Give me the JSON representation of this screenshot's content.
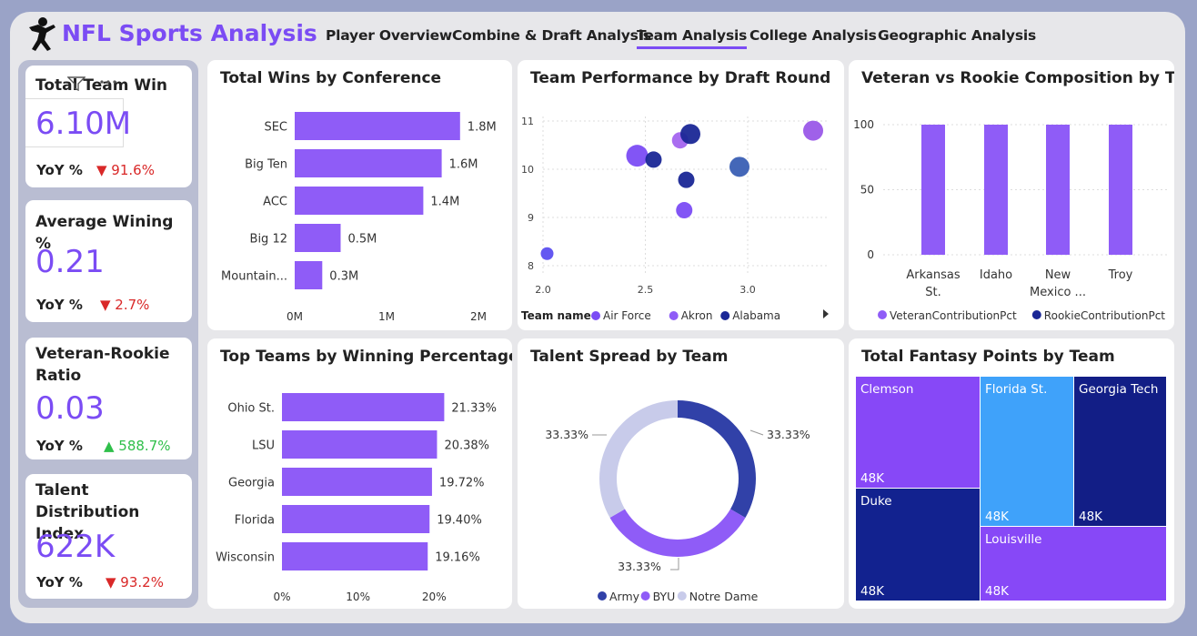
{
  "app": {
    "title": "NFL Sports Analysis"
  },
  "nav": {
    "items": [
      {
        "label": "Player Overview"
      },
      {
        "label": "Combine & Draft Analysis"
      },
      {
        "label": "Team Analysis"
      },
      {
        "label": "College Analysis"
      },
      {
        "label": "Geographic Analysis"
      }
    ],
    "active": "Team Analysis"
  },
  "kpis": [
    {
      "title": "Total Team Win",
      "value": "6.10M",
      "yoy_label": "YoY %",
      "yoy": "▼ 91.6%",
      "direction": "down"
    },
    {
      "title": "Average Wining %",
      "value": "0.21",
      "yoy_label": "YoY %",
      "yoy": "▼ 2.7%",
      "direction": "down"
    },
    {
      "title": "Veteran-Rookie Ratio",
      "value": "0.03",
      "yoy_label": "YoY %",
      "yoy": "▲ 588.7%",
      "direction": "up"
    },
    {
      "title": "Talent Distribution Index",
      "value": "622K",
      "yoy_label": "YoY %",
      "yoy": "▼ 93.2%",
      "direction": "down"
    }
  ],
  "colors": {
    "accent": "#7b4cf4",
    "bar": "#8f5cf7",
    "navy": "#1a2796",
    "blue": "#3a5fb4",
    "light": "#c8cbea",
    "sky": "#3fa2fa",
    "down": "#d92828",
    "up": "#2fbf4a"
  },
  "chart_data": [
    {
      "id": "wins_by_conference",
      "type": "bar",
      "title": "Total Wins by Conference",
      "orientation": "horizontal",
      "categories": [
        "SEC",
        "Big Ten",
        "ACC",
        "Big 12",
        "Mountain..."
      ],
      "values": [
        1.8,
        1.6,
        1.4,
        0.5,
        0.3
      ],
      "value_labels": [
        "1.8M",
        "1.6M",
        "1.4M",
        "0.5M",
        "0.3M"
      ],
      "xlim": [
        0,
        2
      ],
      "xticks": [
        "0M",
        "1M",
        "2M"
      ]
    },
    {
      "id": "top_teams_winning_pct",
      "type": "bar",
      "title": "Top Teams by Winning Percentage",
      "orientation": "horizontal",
      "categories": [
        "Ohio St.",
        "LSU",
        "Georgia",
        "Florida",
        "Wisconsin"
      ],
      "values": [
        21.33,
        20.38,
        19.72,
        19.4,
        19.16
      ],
      "value_labels": [
        "21.33%",
        "20.38%",
        "19.72%",
        "19.40%",
        "19.16%"
      ],
      "xlim": [
        0,
        22
      ],
      "xticks": [
        "0%",
        "10%",
        "20%"
      ]
    },
    {
      "id": "performance_by_draft_round",
      "type": "scatter",
      "title": "Team Performance by Draft Round",
      "xlim": [
        2.0,
        3.4
      ],
      "ylim": [
        8,
        11
      ],
      "xticks": [
        "2.0",
        "2.5",
        "3.0"
      ],
      "yticks": [
        "11",
        "10",
        "9",
        "8"
      ],
      "legend_title": "Team name",
      "legend": [
        {
          "name": "Air Force",
          "color": "#7b4cf4"
        },
        {
          "name": "Akron",
          "color": "#8f5cf7"
        },
        {
          "name": "Alabama",
          "color": "#1a2796"
        }
      ],
      "points": [
        {
          "x": 2.02,
          "y": 8.25,
          "color": "#5c4ff0"
        },
        {
          "x": 2.46,
          "y": 10.28,
          "color": "#7b4cf4"
        },
        {
          "x": 2.54,
          "y": 10.2,
          "color": "#1a2796"
        },
        {
          "x": 2.67,
          "y": 10.6,
          "color": "#a465ef"
        },
        {
          "x": 2.72,
          "y": 10.73,
          "color": "#1a2796"
        },
        {
          "x": 2.7,
          "y": 9.78,
          "color": "#1a2796"
        },
        {
          "x": 2.69,
          "y": 9.15,
          "color": "#7b4cf4"
        },
        {
          "x": 2.96,
          "y": 10.05,
          "color": "#3a5fb4"
        },
        {
          "x": 3.32,
          "y": 10.8,
          "color": "#9a58e8"
        }
      ]
    },
    {
      "id": "veteran_rookie_composition",
      "type": "bar",
      "title": "Veteran vs Rookie Composition by Team",
      "categories": [
        "Arkansas St.",
        "Idaho",
        "New Mexico ...",
        "Troy"
      ],
      "series": [
        {
          "name": "VeteranContributionPct",
          "values": [
            100,
            100,
            100,
            100
          ],
          "color": "#8f5cf7"
        },
        {
          "name": "RookieContributionPct",
          "values": [
            0,
            0,
            0,
            0
          ],
          "color": "#1a2796"
        }
      ],
      "ylim": [
        0,
        110
      ],
      "yticks": [
        "100",
        "50",
        "0"
      ]
    },
    {
      "id": "talent_spread",
      "type": "pie",
      "title": "Talent Spread by Team",
      "donut": true,
      "slices": [
        {
          "name": "Army",
          "value": 33.33,
          "label": "33.33%",
          "color": "#3141a8"
        },
        {
          "name": "BYU",
          "value": 33.33,
          "label": "33.33%",
          "color": "#8f5cf7"
        },
        {
          "name": "Notre Dame",
          "value": 33.33,
          "label": "33.33%",
          "color": "#c8cbea"
        }
      ]
    },
    {
      "id": "fantasy_points",
      "type": "treemap",
      "title": "Total Fantasy Points by Team",
      "cells": [
        {
          "name": "Clemson",
          "label": "48K",
          "color": "#8748f7"
        },
        {
          "name": "Florida St.",
          "label": "48K",
          "color": "#3fa2fa"
        },
        {
          "name": "Georgia Tech",
          "label": "48K",
          "color": "#121e86"
        },
        {
          "name": "Duke",
          "label": "48K",
          "color": "#12228f"
        },
        {
          "name": "Louisville",
          "label": "48K",
          "color": "#8748f7"
        }
      ]
    }
  ]
}
